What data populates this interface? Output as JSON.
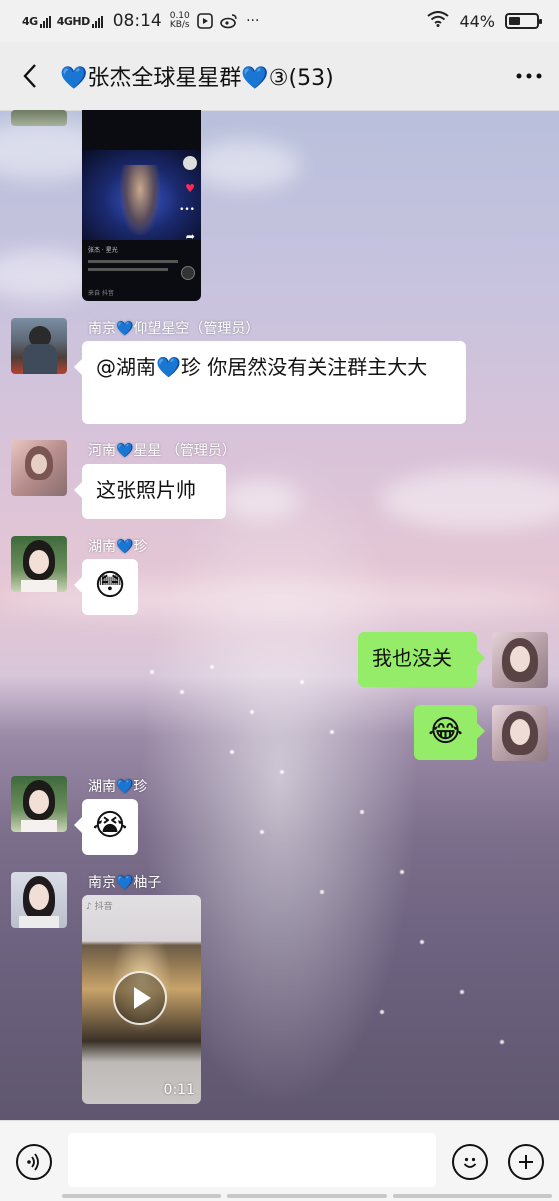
{
  "status_bar": {
    "net1": "4G",
    "net2": "4GHD",
    "time": "08:14",
    "speed_value": "0.10",
    "speed_unit": "KB/s",
    "battery_text": "44%",
    "battery_level": 0.44
  },
  "header": {
    "back_icon": "chevron-left-icon",
    "title": "💙张杰全球星星群💙③(53)",
    "more_icon": "more-dots-icon"
  },
  "messages": [
    {
      "id": "m1",
      "side": "left",
      "type": "video-thumbnail",
      "thumb_caption_1": "张杰 · 星光",
      "thumb_caption_2": "来自 抖音"
    },
    {
      "id": "m2",
      "side": "left",
      "sender": "南京💙仰望星空（管理员）",
      "text": "@湖南💙珍  你居然没有关注群主大大"
    },
    {
      "id": "m3",
      "side": "left",
      "sender": "河南💙星星 （管理员）",
      "text": "这张照片帅"
    },
    {
      "id": "m4",
      "side": "left",
      "sender": "湖南💙珍",
      "text": "😳"
    },
    {
      "id": "m5",
      "side": "right",
      "text": "我也没关"
    },
    {
      "id": "m6",
      "side": "right",
      "text": "😂"
    },
    {
      "id": "m7",
      "side": "left",
      "sender": "湖南💙珍",
      "text": "😭"
    },
    {
      "id": "m8",
      "side": "left",
      "sender": "南京💙柚子",
      "type": "video",
      "duration": "0:11"
    }
  ],
  "input_bar": {
    "voice_icon": "voice-icon",
    "placeholder": "",
    "emoji_icon": "emoji-icon",
    "plus_icon": "plus-icon"
  },
  "colors": {
    "own_bubble": "#95ec69",
    "other_bubble": "#ffffff",
    "status_bg": "#f1f1f1",
    "header_bg": "#ededed"
  }
}
